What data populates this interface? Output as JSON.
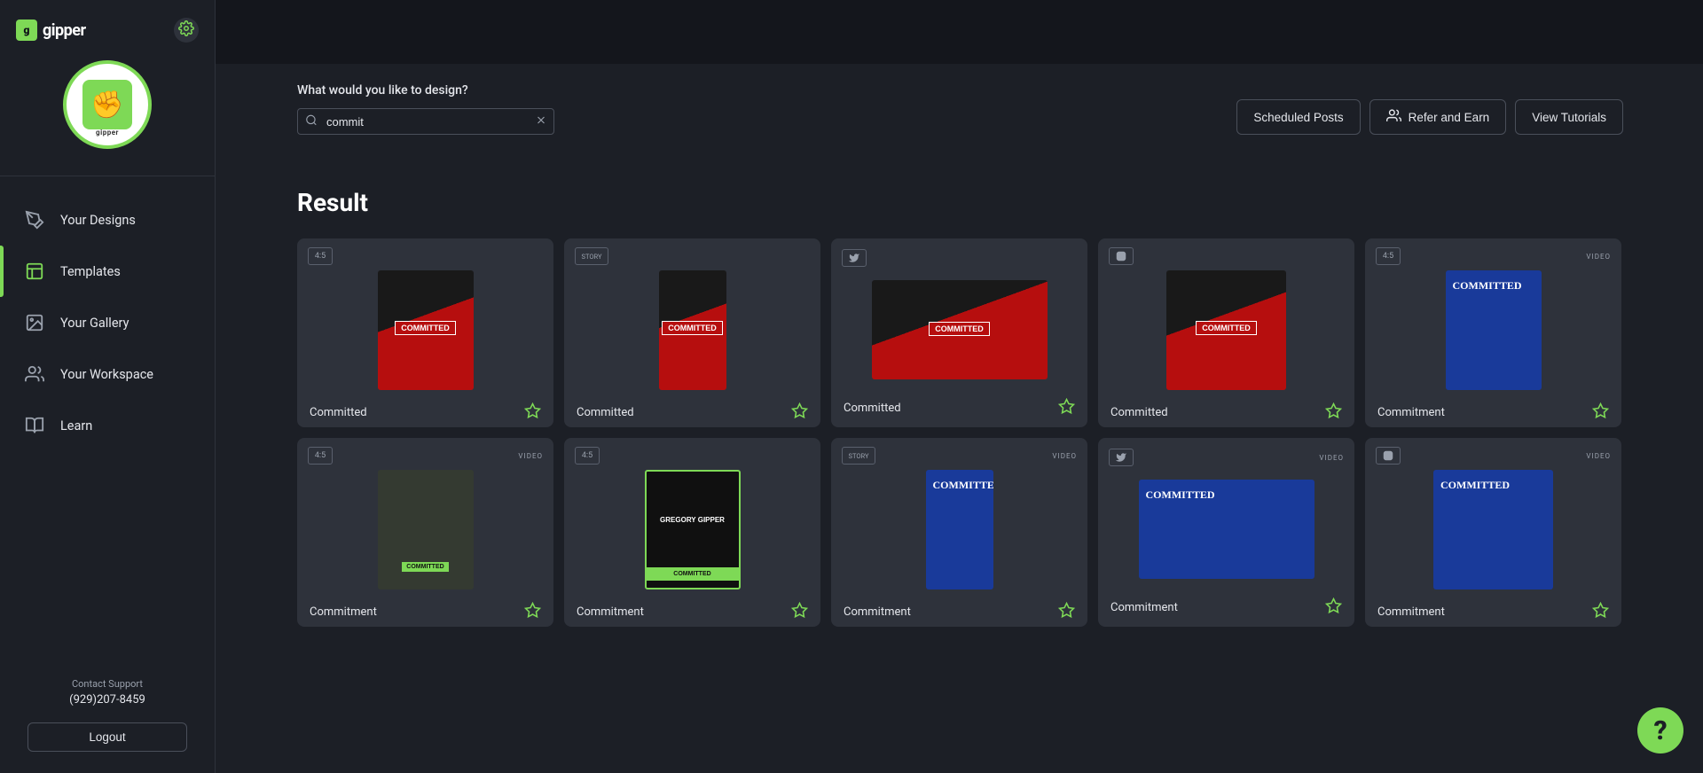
{
  "brand": "gipper",
  "sidebar": {
    "items": [
      {
        "label": "Your Designs",
        "icon": "brush"
      },
      {
        "label": "Templates",
        "icon": "layout",
        "active": true
      },
      {
        "label": "Your Gallery",
        "icon": "image"
      },
      {
        "label": "Your Workspace",
        "icon": "users"
      },
      {
        "label": "Learn",
        "icon": "book"
      }
    ],
    "support_label": "Contact Support",
    "support_phone": "(929)207-8459",
    "logout": "Logout"
  },
  "header": {
    "search_title": "What would you like to design?",
    "search_value": "commit",
    "actions": {
      "scheduled": "Scheduled Posts",
      "refer": "Refer and Earn",
      "tutorials": "View Tutorials"
    }
  },
  "results": {
    "title": "Result",
    "cards": [
      {
        "ratio": "4:5",
        "badge_type": "ratio",
        "video": false,
        "title": "Committed",
        "theme": "red"
      },
      {
        "ratio": "STORY",
        "badge_type": "story",
        "video": false,
        "title": "Committed",
        "theme": "red"
      },
      {
        "ratio": "tw",
        "badge_type": "platform-twitter",
        "video": false,
        "title": "Committed",
        "theme": "red"
      },
      {
        "ratio": "ig",
        "badge_type": "platform-instagram",
        "video": false,
        "title": "Committed",
        "theme": "red"
      },
      {
        "ratio": "4:5",
        "badge_type": "ratio",
        "video": true,
        "title": "Commitment",
        "theme": "blue"
      },
      {
        "ratio": "4:5",
        "badge_type": "ratio",
        "video": true,
        "title": "Commitment",
        "theme": "darkg"
      },
      {
        "ratio": "4:5",
        "badge_type": "ratio",
        "video": false,
        "title": "Commitment",
        "theme": "green"
      },
      {
        "ratio": "STORY",
        "badge_type": "story",
        "video": true,
        "title": "Commitment",
        "theme": "blue"
      },
      {
        "ratio": "tw",
        "badge_type": "platform-twitter",
        "video": true,
        "title": "Commitment",
        "theme": "blue"
      },
      {
        "ratio": "ig",
        "badge_type": "platform-instagram",
        "video": true,
        "title": "Commitment",
        "theme": "blue"
      }
    ],
    "video_label": "VIDEO"
  },
  "help_glyph": "?"
}
